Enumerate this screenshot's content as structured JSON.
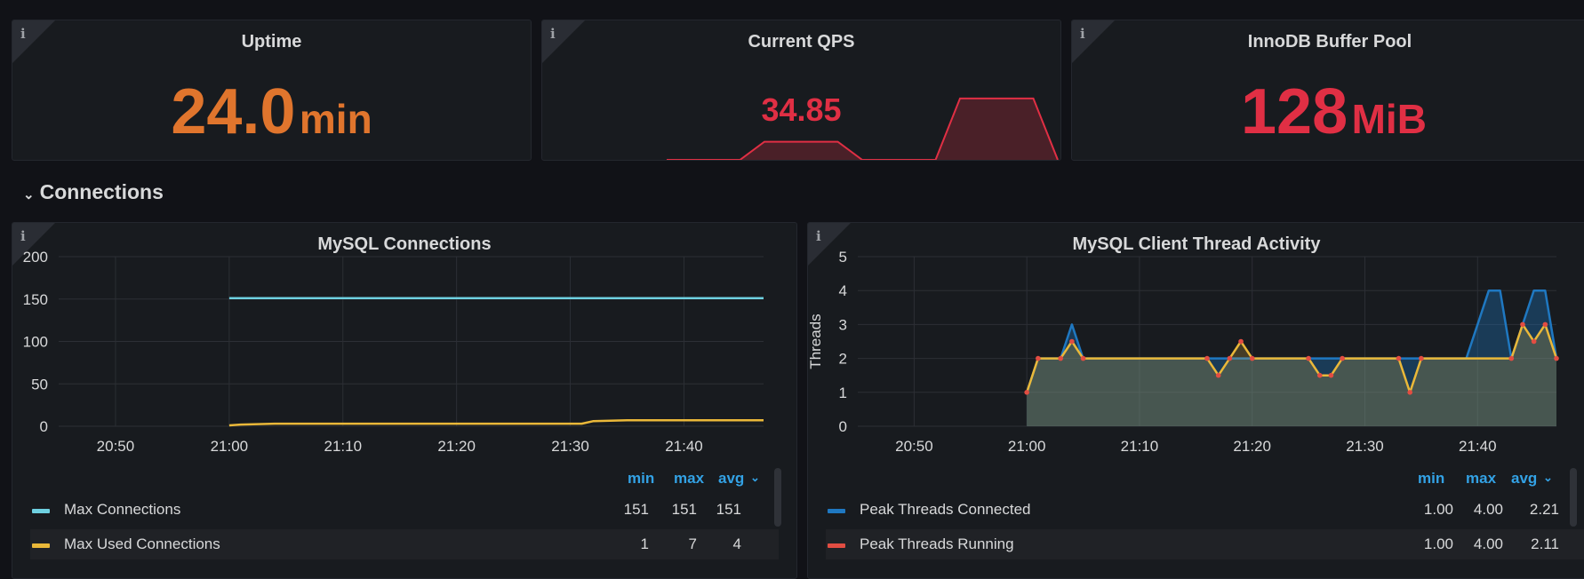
{
  "stats": {
    "uptime": {
      "title": "Uptime",
      "value": "24.0",
      "unit": "min",
      "color": "#e0752d"
    },
    "qps": {
      "title": "Current QPS",
      "value": "34.85",
      "color": "#e02f44",
      "sparkline": [
        0,
        0,
        0,
        0,
        0.13,
        0.13,
        0.13,
        0.13,
        0,
        0,
        0,
        0,
        0.44,
        0.44,
        0.44,
        0.44,
        0
      ]
    },
    "innodb": {
      "title": "InnoDB Buffer Pool",
      "value": "128",
      "unit": "MiB",
      "color": "#e02f44"
    }
  },
  "row": {
    "title": "Connections"
  },
  "conn_panel": {
    "title": "MySQL Connections",
    "legend": {
      "headers": {
        "min": "min",
        "max": "max",
        "avg": "avg"
      },
      "sort_icon": "chevron-down-icon",
      "items": [
        {
          "name": "Max Connections",
          "min": "151",
          "max": "151",
          "avg": "151",
          "color": "#6ed0e0"
        },
        {
          "name": "Max Used Connections",
          "min": "1",
          "max": "7",
          "avg": "4",
          "color": "#eab839"
        }
      ]
    }
  },
  "thread_panel": {
    "title": "MySQL Client Thread Activity",
    "legend": {
      "headers": {
        "min": "min",
        "max": "max",
        "avg": "avg"
      },
      "sort_icon": "chevron-down-icon",
      "items": [
        {
          "name": "Peak Threads Connected",
          "min": "1.00",
          "max": "4.00",
          "avg": "2.21",
          "color": "#1f78c1"
        },
        {
          "name": "Peak Threads Running",
          "min": "1.00",
          "max": "4.00",
          "avg": "2.11",
          "color": "#e24d42"
        }
      ]
    }
  },
  "chart_data": [
    {
      "type": "line",
      "title": "MySQL Connections",
      "xlabel": "",
      "ylabel": "",
      "x_ticks": [
        "20:50",
        "21:00",
        "21:10",
        "21:20",
        "21:30",
        "21:40"
      ],
      "y_ticks": [
        "0",
        "50",
        "100",
        "150",
        "200"
      ],
      "ylim": [
        0,
        200
      ],
      "x_range": [
        "20:45",
        "21:47"
      ],
      "series": [
        {
          "name": "Max Connections",
          "color": "#6ed0e0",
          "x": [
            "21:00",
            "21:47"
          ],
          "y": [
            151,
            151
          ]
        },
        {
          "name": "Max Used Connections",
          "color": "#eab839",
          "x": [
            "21:00",
            "21:01",
            "21:04",
            "21:31",
            "21:32",
            "21:35",
            "21:47"
          ],
          "y": [
            1,
            2,
            3,
            3,
            6,
            7,
            7
          ]
        }
      ],
      "grid": true,
      "legend_position": "bottom"
    },
    {
      "type": "area",
      "title": "MySQL Client Thread Activity",
      "xlabel": "",
      "ylabel": "Threads",
      "x_ticks": [
        "20:50",
        "21:00",
        "21:10",
        "21:20",
        "21:30",
        "21:40"
      ],
      "y_ticks": [
        "0",
        "1",
        "2",
        "3",
        "4",
        "5"
      ],
      "ylim": [
        0,
        5
      ],
      "x_range": [
        "20:45",
        "21:47"
      ],
      "x": [
        "21:00",
        "21:01",
        "21:02",
        "21:03",
        "21:04",
        "21:05",
        "21:06",
        "21:07",
        "21:08",
        "21:09",
        "21:10",
        "21:11",
        "21:12",
        "21:13",
        "21:14",
        "21:15",
        "21:16",
        "21:17",
        "21:18",
        "21:19",
        "21:20",
        "21:21",
        "21:22",
        "21:23",
        "21:24",
        "21:25",
        "21:26",
        "21:27",
        "21:28",
        "21:29",
        "21:30",
        "21:31",
        "21:32",
        "21:33",
        "21:34",
        "21:35",
        "21:36",
        "21:37",
        "21:38",
        "21:39",
        "21:40",
        "21:41",
        "21:42",
        "21:43",
        "21:44",
        "21:45",
        "21:46",
        "21:47"
      ],
      "series": [
        {
          "name": "Peak Threads Connected",
          "color": "#1f78c1",
          "values": [
            1,
            2,
            2,
            2,
            3,
            2,
            2,
            2,
            2,
            2,
            2,
            2,
            2,
            2,
            2,
            2,
            2,
            2,
            2,
            2,
            2,
            2,
            2,
            2,
            2,
            2,
            2,
            2,
            2,
            2,
            2,
            2,
            2,
            2,
            2,
            2,
            2,
            2,
            2,
            2,
            3,
            4,
            4,
            2,
            3,
            4,
            4,
            2
          ]
        },
        {
          "name": "Peak Threads Running",
          "color": "#e24d42",
          "values": [
            1,
            2,
            2,
            2,
            2.5,
            2,
            2,
            2,
            2,
            2,
            2,
            2,
            2,
            2,
            2,
            2,
            2,
            1.5,
            2,
            2.5,
            2,
            2,
            2,
            2,
            2,
            2,
            1.5,
            1.5,
            2,
            2,
            2,
            2,
            2,
            2,
            1,
            2,
            2,
            2,
            2,
            2,
            2,
            2,
            2,
            2,
            3,
            2.5,
            3,
            2
          ]
        }
      ],
      "grid": true,
      "legend_position": "bottom"
    }
  ]
}
